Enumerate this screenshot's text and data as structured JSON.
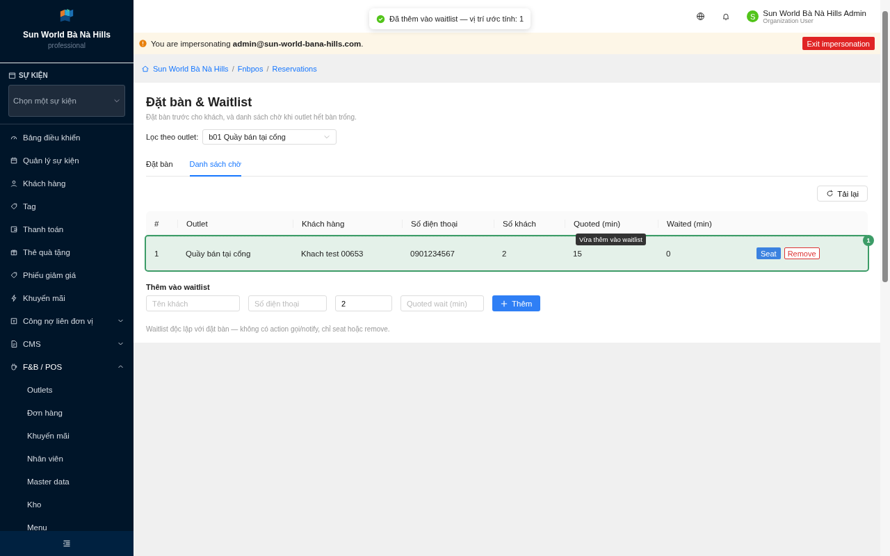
{
  "sidebar": {
    "brand": {
      "name": "Sun World Bà Nà Hills",
      "plan": "professional"
    },
    "event_section": {
      "label": "SỰ KIỆN",
      "placeholder": "Chọn một sự kiện"
    },
    "menu": [
      {
        "label": "Bảng điều khiển"
      },
      {
        "label": "Quản lý sự kiện"
      },
      {
        "label": "Khách hàng"
      },
      {
        "label": "Tag"
      },
      {
        "label": "Thanh toán"
      },
      {
        "label": "Thẻ quà tặng"
      },
      {
        "label": "Phiếu giảm giá"
      },
      {
        "label": "Khuyến mãi"
      },
      {
        "label": "Công nợ liên đơn vị",
        "expanded": false
      },
      {
        "label": "CMS",
        "expanded": false
      },
      {
        "label": "F&B / POS",
        "expanded": true,
        "children": [
          {
            "label": "Outlets"
          },
          {
            "label": "Đơn hàng"
          },
          {
            "label": "Khuyến mãi"
          },
          {
            "label": "Nhân viên"
          },
          {
            "label": "Master data"
          },
          {
            "label": "Kho"
          },
          {
            "label": "Menu"
          }
        ]
      }
    ]
  },
  "header": {
    "user": {
      "avatar": "S",
      "name": "Sun World Bà Nà Hills Admin",
      "role": "Organization User"
    }
  },
  "toast": {
    "text": "Đã thêm vào waitlist — vị trí ước tính: 1"
  },
  "banner": {
    "text": "You are impersonating **admin@sun-world-bana-hills.com**.",
    "button": "Exit impersonation"
  },
  "breadcrumb": [
    {
      "label": "Sun World Bà Nà Hills"
    },
    {
      "separator": "/",
      "label": "Fnbpos"
    },
    {
      "separator": "/",
      "label": "Reservations"
    }
  ],
  "page": {
    "title": "Đặt bàn & Waitlist",
    "subtitle": "Đặt bàn trước cho khách, và danh sách chờ khi outlet hết bàn trống.",
    "filter": {
      "label": "Lọc theo outlet:",
      "value": "b01 Quầy bán tại cổng"
    },
    "tabs": [
      {
        "label": "Đặt bàn",
        "selected": false
      },
      {
        "label": "Danh sách chờ",
        "selected": true
      }
    ],
    "reload": "Tải lại",
    "table": {
      "columns": [
        "#",
        "Outlet",
        "Khách hàng",
        "Số điện thoại",
        "Số khách",
        "Quoted (min)",
        "Waited (min)"
      ],
      "rows": [
        {
          "cells": [
            "1",
            "Quầy bán tại cổng",
            "Khach test 00653",
            "0901234567",
            "2",
            "15",
            "0"
          ],
          "actions": [
            "Seat",
            "Remove"
          ],
          "highlighted": true,
          "tooltip": "Vừa thêm vào waitlist",
          "badge": "1"
        }
      ]
    },
    "add_form": {
      "title": "Thêm vào waitlist",
      "fields": [
        {
          "placeholder": "Tên khách"
        },
        {
          "placeholder": "Số điện thoại"
        },
        {
          "value": "2"
        },
        {
          "placeholder": "Quoted wait (min)"
        }
      ],
      "button": "Thêm"
    },
    "footnote": "Waitlist độc lập với đặt bàn — không có action gọi/notify, chỉ seat hoặc remove."
  }
}
